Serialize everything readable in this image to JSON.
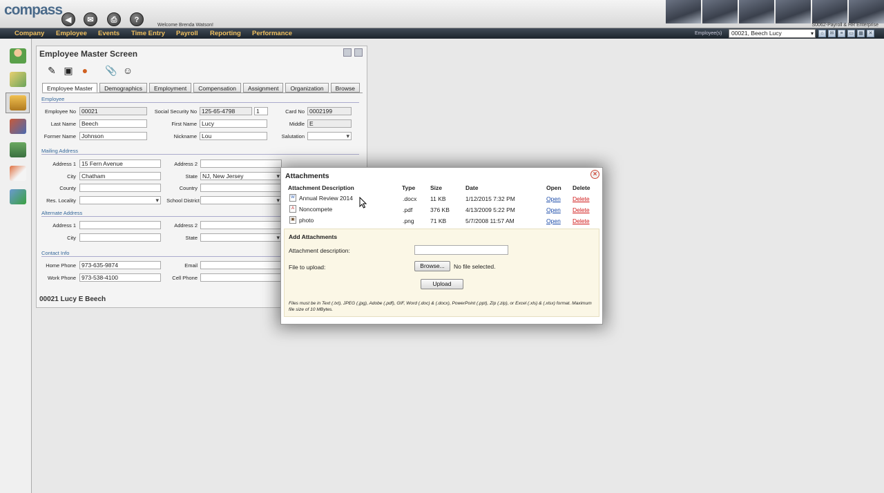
{
  "app": {
    "logo": "compass",
    "welcome": "Welcome Brenda Watson!",
    "enterprise": "S0062-Payroll & HR Enterprise"
  },
  "menu": {
    "items": [
      "Company",
      "Employee",
      "Events",
      "Time Entry",
      "Payroll",
      "Reporting",
      "Performance"
    ],
    "employee_label": "Employee(s)",
    "employee_selected": "00021, Beech Lucy"
  },
  "panel": {
    "title": "Employee Master Screen",
    "tabs": [
      "Employee Master",
      "Demographics",
      "Employment",
      "Compensation",
      "Assignment",
      "Organization",
      "Browse"
    ],
    "sections": {
      "employee": "Employee",
      "mailing": "Mailing Address",
      "alternate": "Alternate Address",
      "contact": "Contact Info"
    },
    "labels": {
      "employee_no": "Employee No",
      "ssn": "Social Security No",
      "card_no": "Card No",
      "last_name": "Last Name",
      "first_name": "First Name",
      "middle": "Middle",
      "former_name": "Former Name",
      "nickname": "Nickname",
      "salutation": "Salutation",
      "address1": "Address 1",
      "address2": "Address 2",
      "city": "City",
      "state": "State",
      "county": "County",
      "country": "Country",
      "res_locality": "Res. Locality",
      "school_district": "School District",
      "home_phone": "Home Phone",
      "email": "Email",
      "work_phone": "Work Phone",
      "cell_phone": "Cell Phone"
    },
    "values": {
      "employee_no": "00021",
      "ssn": "125-65-4798",
      "ssn_suffix": "1",
      "card_no": "0002199",
      "last_name": "Beech",
      "first_name": "Lucy",
      "middle": "E",
      "former_name": "Johnson",
      "nickname": "Lou",
      "address1": "15 Fern Avenue",
      "city": "Chatham",
      "state": "NJ, New Jersey",
      "home_phone": "973-635-9874",
      "work_phone": "973-538-4100"
    },
    "footer": "00021 Lucy E Beech"
  },
  "modal": {
    "title": "Attachments",
    "columns": [
      "Attachment Description",
      "Type",
      "Size",
      "Date",
      "Open",
      "Delete"
    ],
    "rows": [
      {
        "icon": "word-doc-icon",
        "desc": "Annual Review 2014",
        "type": ".docx",
        "size": "11 KB",
        "date": "1/12/2015 7:32 PM",
        "open": "Open",
        "delete": "Delete"
      },
      {
        "icon": "pdf-icon",
        "desc": "Noncompete",
        "type": ".pdf",
        "size": "376 KB",
        "date": "4/13/2009 5:22 PM",
        "open": "Open",
        "delete": "Delete"
      },
      {
        "icon": "image-icon",
        "desc": "photo",
        "type": ".png",
        "size": "71 KB",
        "date": "5/7/2008 11:57 AM",
        "open": "Open",
        "delete": "Delete"
      }
    ],
    "add": {
      "title": "Add Attachments",
      "desc_label": "Attachment description:",
      "desc_value": "",
      "file_label": "File to upload:",
      "browse": "Browse...",
      "no_file": "No file selected.",
      "upload": "Upload",
      "note": "Files must be in Text (.txt), JPEG (.jpg), Adobe (.pdf), GIF, Word (.doc) & (.docx), PowerPoint (.ppt), Zip (.zip), or Excel (.xls) & (.xlsx) format. Maximum file size of 10 MBytes."
    }
  }
}
